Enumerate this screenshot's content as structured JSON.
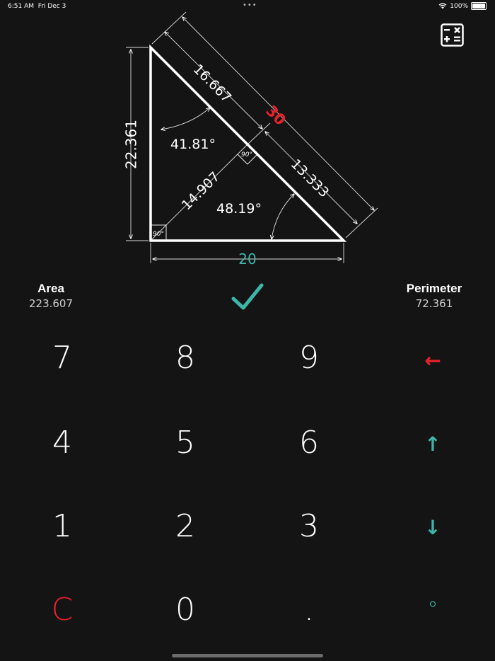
{
  "status_bar": {
    "time": "6:51 AM",
    "date": "Fri Dec 3",
    "dots": "•••",
    "battery": "100%"
  },
  "colors": {
    "background": "#141414",
    "accent_red": "#e8222a",
    "accent_teal": "#3cb6a8"
  },
  "triangle": {
    "side_left": "22.361",
    "side_bottom": "20",
    "hypotenuse": "30",
    "hyp_upper_segment": "16.667",
    "hyp_lower_segment": "13.333",
    "altitude": "14.907",
    "angle_top": "41.81°",
    "angle_right": "48.19°",
    "right_angle_label": "90°"
  },
  "area": {
    "label": "Area",
    "value": "223.607"
  },
  "perimeter": {
    "label": "Perimeter",
    "value": "72.361"
  },
  "keypad": {
    "k7": "7",
    "k8": "8",
    "k9": "9",
    "k4": "4",
    "k5": "5",
    "k6": "6",
    "k1": "1",
    "k2": "2",
    "k3": "3",
    "clear": "C",
    "k0": "0",
    "dot": ".",
    "back": "←",
    "up": "↑",
    "down": "↓",
    "degree": "°"
  },
  "icons": {
    "calculator": "calculator-icon",
    "confirm": "checkmark-icon"
  }
}
